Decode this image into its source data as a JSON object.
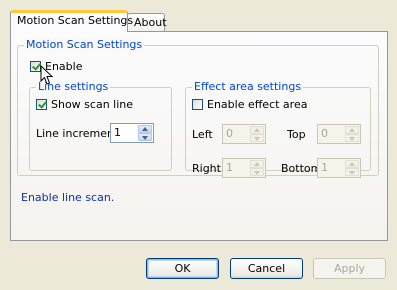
{
  "tabs": [
    {
      "label": "Motion Scan Settings",
      "active": true
    },
    {
      "label": "About",
      "active": false
    }
  ],
  "motion_group": {
    "title": "Motion Scan Settings",
    "enable_label": "Enable",
    "enable_checked": true
  },
  "line_group": {
    "title": "Line settings",
    "show_scan_line_label": "Show scan line",
    "show_scan_line_checked": true,
    "line_increment_label": "Line increment",
    "line_increment_value": "1"
  },
  "effect_group": {
    "title": "Effect area settings",
    "enable_effect_label": "Enable effect area",
    "enable_effect_checked": false,
    "left_label": "Left",
    "left_value": "0",
    "top_label": "Top",
    "top_value": "0",
    "right_label": "Right",
    "right_value": "1",
    "bottom_label": "Bottom",
    "bottom_value": "1"
  },
  "status_text": "Enable line scan.",
  "buttons": {
    "ok": "OK",
    "cancel": "Cancel",
    "apply": "Apply"
  },
  "colors": {
    "legend_blue": "#0046d5",
    "status_blue": "#0b31a6",
    "tab_highlight": "#ffc83c",
    "dialog_bg": "#ece9d8"
  }
}
